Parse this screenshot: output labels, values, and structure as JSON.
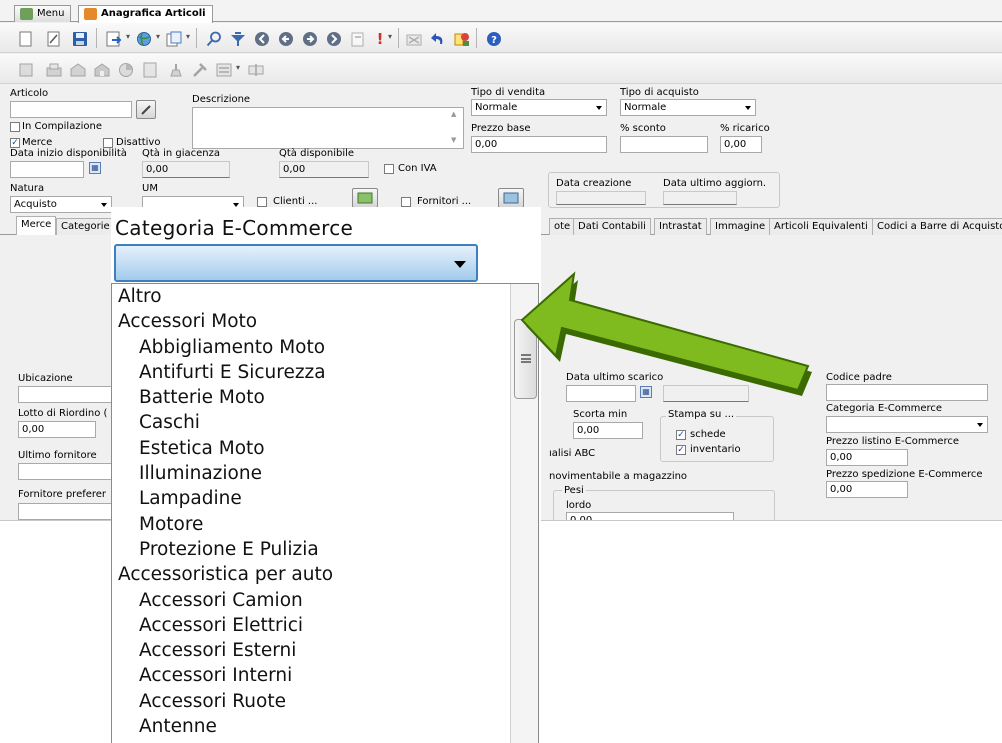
{
  "window_tabs": [
    {
      "label": "Menu"
    },
    {
      "label": "Anagrafica Articoli"
    }
  ],
  "toolbar1_icons": [
    "new-document-icon",
    "edit-document-icon",
    "save-icon",
    "export-icon",
    "world-icon",
    "copy-icon",
    "search-icon",
    "filter-icon",
    "first-record-icon",
    "previous-record-icon",
    "next-record-icon",
    "last-record-icon",
    "copy-page-icon",
    "exclamation-icon",
    "cancel-icon",
    "undo-icon",
    "rules-icon",
    "help-icon"
  ],
  "toolbar2_icons": [
    "items-icon",
    "stock-icon",
    "warehouse-icon",
    "warehouse-2-icon",
    "chart-icon",
    "document-icon",
    "scale-icon",
    "tools-icon",
    "view-icon",
    "rename-icon"
  ],
  "colors": {
    "accent": "#3f7fbf",
    "arrow_green": "#7fba1f",
    "arrow_dark": "#3a6a00",
    "check_blue": "#1a4fa0"
  },
  "form": {
    "articolo_label": "Articolo",
    "articolo_value": "",
    "descrizione_label": "Descrizione",
    "descrizione_value": "",
    "in_compilazione_label": "In Compilazione",
    "merce_label": "Merce",
    "disattivo_label": "Disattivo",
    "data_inizio_label": "Data inizio disponibilità",
    "qta_giacenza_label": "Qtà in giacenza",
    "qta_giacenza_value": "0,00",
    "qta_disponibile_label": "Qtà disponibile",
    "qta_disponibile_value": "0,00",
    "con_iva_label": "Con IVA",
    "natura_label": "Natura",
    "natura_value": "Acquisto",
    "um_label": "UM",
    "um_value": "",
    "clienti_label": "Clienti ...",
    "fornitori_label": "Fornitori ...",
    "tipo_vendita_label": "Tipo di vendita",
    "tipo_vendita_value": "Normale",
    "tipo_acquisto_label": "Tipo di acquisto",
    "tipo_acquisto_value": "Normale",
    "prezzo_base_label": "Prezzo base",
    "prezzo_base_value": "0,00",
    "sconto_label": "% sconto",
    "sconto_value": "",
    "ricarico_label": "% ricarico",
    "ricarico_value": "0,00",
    "data_creazione_label": "Data creazione",
    "data_ultimo_aggiorn_label": "Data ultimo aggiorn."
  },
  "section_tabs": [
    "Merce",
    "Categorie",
    "ote",
    "Dati Contabili",
    "Intrastat",
    "Immagine",
    "Articoli Equivalenti",
    "Codici a Barre di Acquisto"
  ],
  "detail": {
    "ubicazione_label": "Ubicazione",
    "lotto_label": "Lotto di Riordino (",
    "lotto_value": "0,00",
    "ultimo_fornitore_label": "Ultimo fornitore",
    "fornitore_preferito_label": "Fornitore preferer",
    "data_ultimo_scarico_label": "Data ultimo scarico",
    "scorta_min_label": "Scorta min",
    "scorta_min_value": "0,00",
    "stampa_su_label": "Stampa su ...",
    "schede_label": "schede",
    "inventario_label": "inventario",
    "analisi_label": "ıalisi ABC",
    "movimentabile_label": "novimentabile a magazzino",
    "pesi_label": "Pesi",
    "lordo_label": "lordo",
    "lordo_value": "0,00",
    "codice_padre_label": "Codice padre",
    "categoria_ecommerce_label": "Categoria E-Commerce",
    "prezzo_listino_label": "Prezzo listino E-Commerce",
    "prezzo_listino_value": "0,00",
    "prezzo_spedizione_label": "Prezzo spedizione E-Commerce",
    "prezzo_spedizione_value": "0,00"
  },
  "zoom_dropdown": {
    "title": "Categoria E-Commerce",
    "selected_value": "",
    "options": [
      {
        "label": "Altro",
        "level": 1
      },
      {
        "label": "Accessori Moto",
        "level": 1
      },
      {
        "label": "Abbigliamento Moto",
        "level": 2
      },
      {
        "label": "Antifurti E Sicurezza",
        "level": 2
      },
      {
        "label": "Batterie Moto",
        "level": 2
      },
      {
        "label": "Caschi",
        "level": 2
      },
      {
        "label": "Estetica Moto",
        "level": 2
      },
      {
        "label": "Illuminazione",
        "level": 2
      },
      {
        "label": "Lampadine",
        "level": 2
      },
      {
        "label": "Motore",
        "level": 2
      },
      {
        "label": "Protezione E Pulizia",
        "level": 2
      },
      {
        "label": "Accessoristica per auto",
        "level": 1
      },
      {
        "label": "Accessori Camion",
        "level": 2
      },
      {
        "label": "Accessori Elettrici",
        "level": 2
      },
      {
        "label": "Accessori Esterni",
        "level": 2
      },
      {
        "label": "Accessori Interni",
        "level": 2
      },
      {
        "label": "Accessori Ruote",
        "level": 2
      },
      {
        "label": "Antenne",
        "level": 2
      }
    ]
  }
}
